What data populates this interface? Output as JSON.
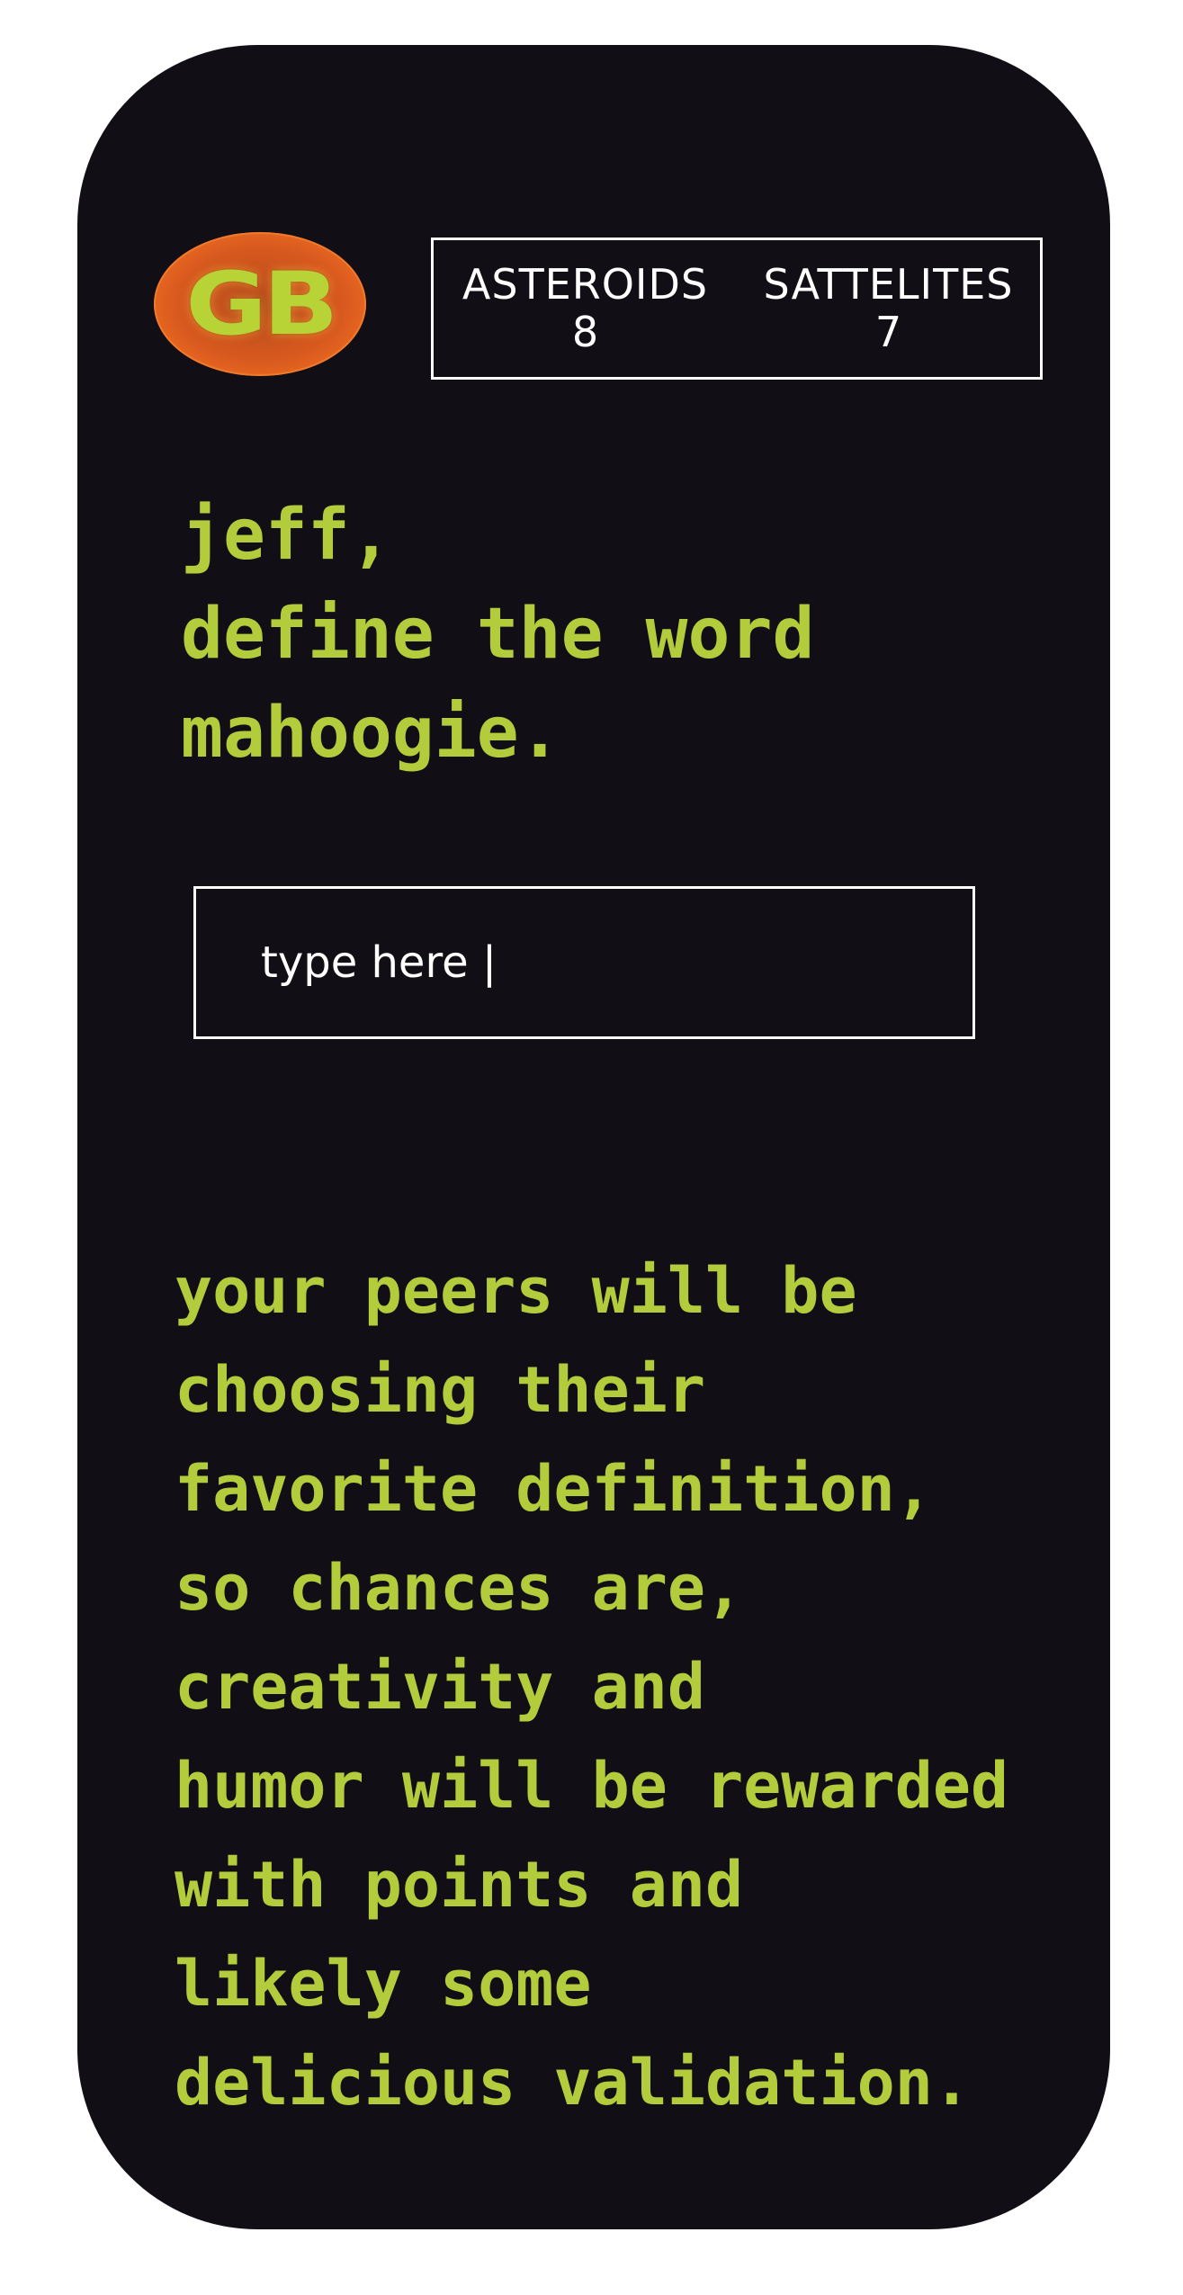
{
  "logo": {
    "text": "GB"
  },
  "scoreboard": {
    "asteroids_label": "ASTEROIDS",
    "asteroids_value": "8",
    "satellites_label": "SATTELITES",
    "satellites_value": "7"
  },
  "prompt": {
    "lines": [
      "jeff,",
      "define the word",
      "mahoogie."
    ]
  },
  "answer": {
    "placeholder": "type here |",
    "value": ""
  },
  "info": {
    "lines": [
      "your peers will be",
      "choosing their",
      "favorite definition,",
      "so chances are,",
      "creativity and",
      "humor will be rewarded",
      "with points and",
      "likely some",
      "delicious validation."
    ]
  },
  "colors": {
    "background": "#120e16",
    "accent_green": "#b2cc3c",
    "logo_orange": "#e8631f",
    "text_white": "#ffffff"
  }
}
